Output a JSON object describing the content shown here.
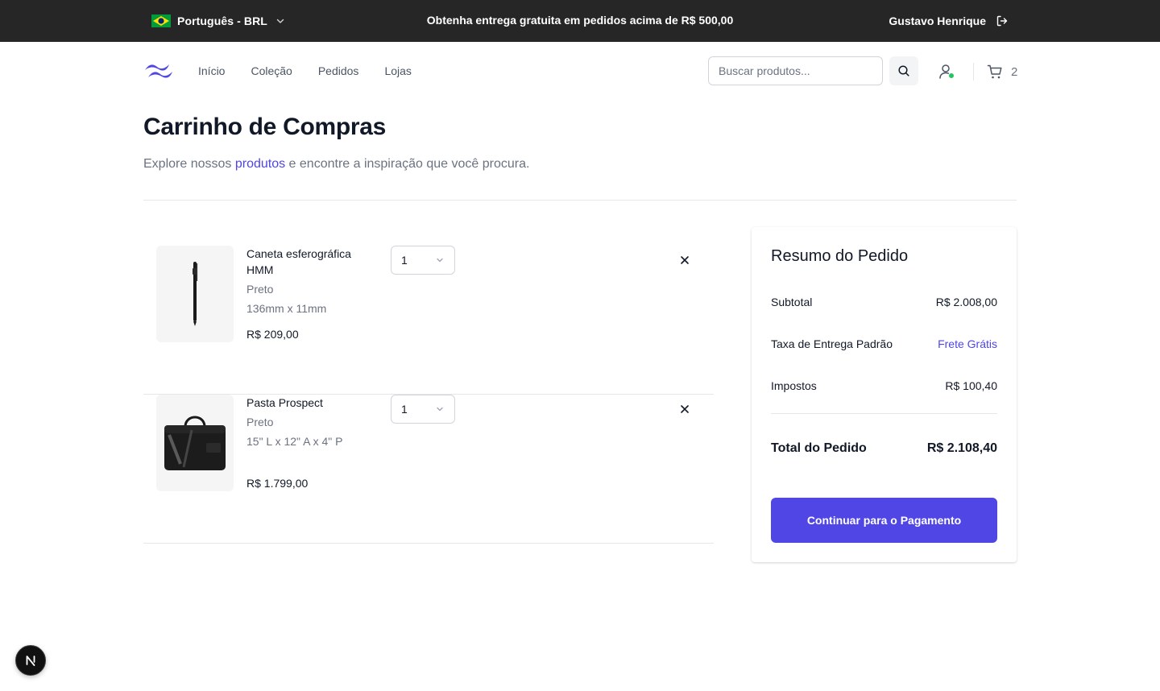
{
  "topbar": {
    "locale_label": "Português - BRL",
    "promo_text": "Obtenha entrega gratuita em pedidos acima de R$ 500,00",
    "user_name": "Gustavo Henrique"
  },
  "nav": {
    "links": [
      "Início",
      "Coleção",
      "Pedidos",
      "Lojas"
    ],
    "search_placeholder": "Buscar produtos...",
    "cart_count": "2"
  },
  "page": {
    "title": "Carrinho de Compras",
    "subtitle_before": "Explore nossos ",
    "subtitle_link": "produtos",
    "subtitle_after": " e encontre a inspiração que você procura."
  },
  "cart": {
    "items": [
      {
        "name": "Caneta esferográfica HMM",
        "color": "Preto",
        "size": "136mm x 11mm",
        "price": "R$ 209,00",
        "quantity": "1"
      },
      {
        "name": "Pasta Prospect",
        "color": "Preto",
        "size": "15\" L x 12\" A x 4\" P",
        "price": "R$ 1.799,00",
        "quantity": "1"
      }
    ]
  },
  "summary": {
    "title": "Resumo do Pedido",
    "subtotal_label": "Subtotal",
    "subtotal_value": "R$ 2.008,00",
    "shipping_label": "Taxa de Entrega Padrão",
    "shipping_value": "Frete Grátis",
    "taxes_label": "Impostos",
    "taxes_value": "R$ 100,40",
    "total_label": "Total do Pedido",
    "total_value": "R$ 2.108,40",
    "checkout_label": "Continuar para o Pagamento"
  },
  "colors": {
    "accent": "#4f46e5",
    "topbar_bg": "#262626",
    "online_dot": "#22c55e"
  },
  "icons": [
    "brazil-flag-icon",
    "chevron-down-icon",
    "logout-icon",
    "logo-icon",
    "search-icon",
    "user-icon",
    "cart-icon",
    "close-icon",
    "nextjs-icon"
  ]
}
